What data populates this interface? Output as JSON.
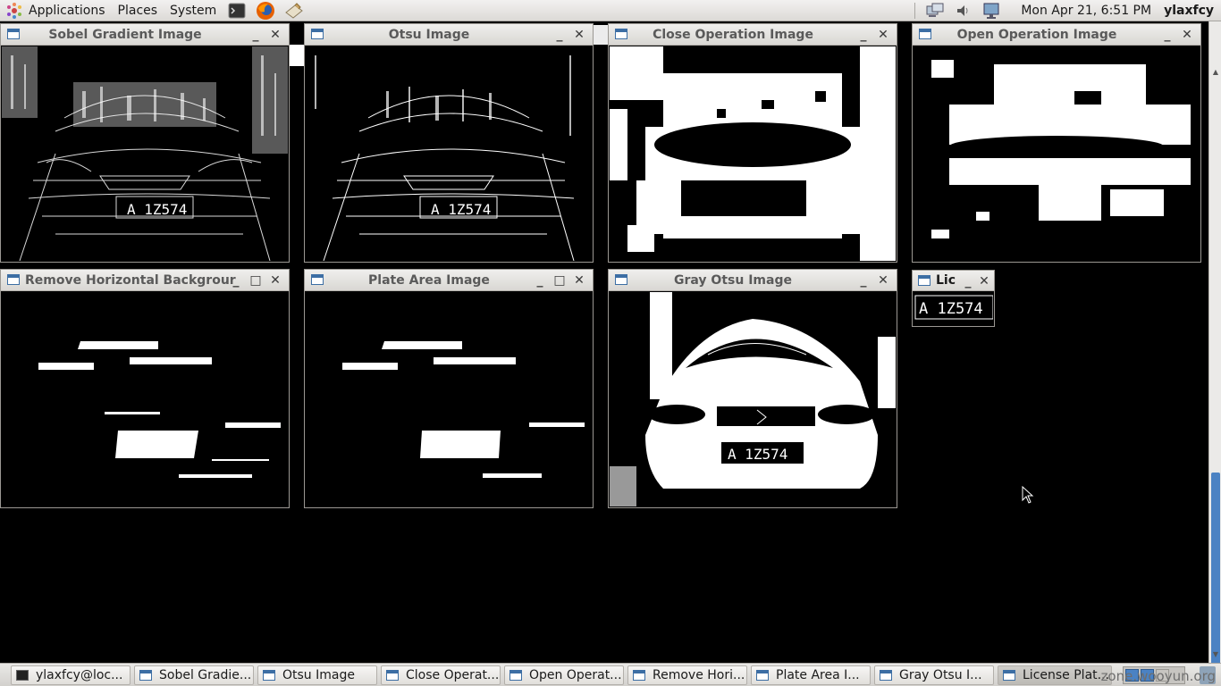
{
  "top_panel": {
    "menu_applications": "Applications",
    "menu_places": "Places",
    "menu_system": "System",
    "clock": "Mon Apr 21,  6:51 PM",
    "username": "ylaxfcy"
  },
  "windows": {
    "sobel": {
      "title": "Sobel Gradient Image"
    },
    "otsu": {
      "title": "Otsu Image"
    },
    "close_op": {
      "title": "Close Operation Image"
    },
    "open_op": {
      "title": "Open Operation Image"
    },
    "remove_horiz": {
      "title": "Remove Horizontal Backgrour"
    },
    "plate_area": {
      "title": "Plate Area Image"
    },
    "gray_otsu": {
      "title": "Gray Otsu Image"
    },
    "license_plate": {
      "title": "Lic",
      "plate_text": "A 1Z574"
    }
  },
  "plate_text": "A 1Z574",
  "taskbar": {
    "items": [
      {
        "label": "ylaxfcy@loc..."
      },
      {
        "label": "Sobel Gradie..."
      },
      {
        "label": "Otsu Image"
      },
      {
        "label": "Close Operat..."
      },
      {
        "label": "Open Operat..."
      },
      {
        "label": "Remove Hori..."
      },
      {
        "label": "Plate Area I..."
      },
      {
        "label": "Gray Otsu I..."
      },
      {
        "label": "License Plat..."
      }
    ]
  },
  "watermark": "zone.wooyun.org",
  "colors": {
    "panel_bg": "#e6e5e3",
    "scroll_thumb": "#4b82c3",
    "window_icon": "#3c6ea4"
  }
}
